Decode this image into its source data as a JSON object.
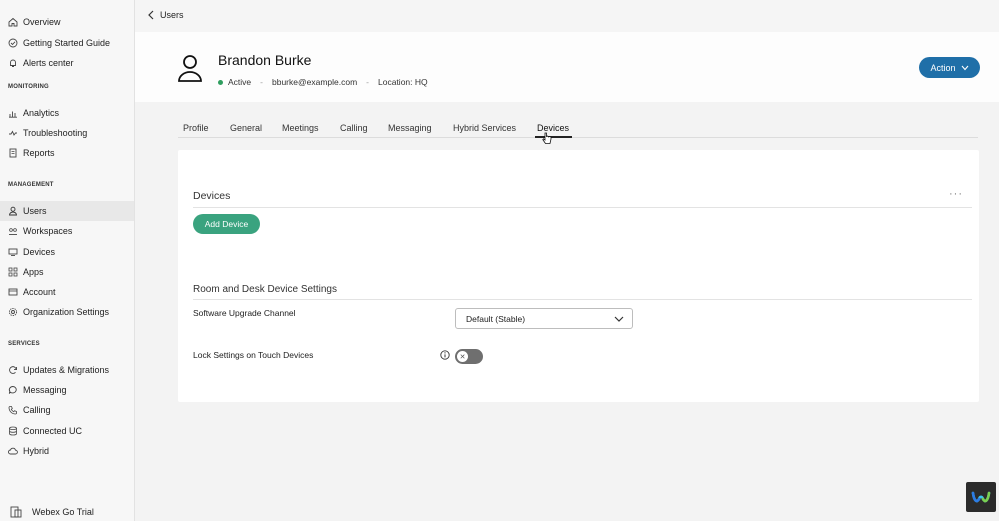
{
  "sidebar": {
    "top_items": [
      {
        "label": "Overview",
        "icon": "home-icon"
      },
      {
        "label": "Getting Started Guide",
        "icon": "check-circle-icon"
      },
      {
        "label": "Alerts center",
        "icon": "bell-icon"
      }
    ],
    "monitoring": {
      "label": "MONITORING",
      "items": [
        {
          "label": "Analytics",
          "icon": "bar-chart-icon"
        },
        {
          "label": "Troubleshooting",
          "icon": "pulse-icon"
        },
        {
          "label": "Reports",
          "icon": "report-icon"
        }
      ]
    },
    "management": {
      "label": "MANAGEMENT",
      "items": [
        {
          "label": "Users",
          "icon": "user-icon"
        },
        {
          "label": "Workspaces",
          "icon": "workspaces-icon"
        },
        {
          "label": "Devices",
          "icon": "device-icon"
        },
        {
          "label": "Apps",
          "icon": "apps-icon"
        },
        {
          "label": "Account",
          "icon": "account-icon"
        },
        {
          "label": "Organization Settings",
          "icon": "gear-icon"
        }
      ]
    },
    "services": {
      "label": "SERVICES",
      "items": [
        {
          "label": "Updates & Migrations",
          "icon": "refresh-icon"
        },
        {
          "label": "Messaging",
          "icon": "message-icon"
        },
        {
          "label": "Calling",
          "icon": "phone-icon"
        },
        {
          "label": "Connected UC",
          "icon": "database-icon"
        },
        {
          "label": "Hybrid",
          "icon": "cloud-icon"
        }
      ]
    },
    "trial_label": "Webex Go Trial"
  },
  "breadcrumb": {
    "back_label": "Users"
  },
  "user": {
    "name": "Brandon Burke",
    "status": "Active",
    "email": "bburke@example.com",
    "location": "Location: HQ"
  },
  "action_button": {
    "label": "Action"
  },
  "tabs": [
    {
      "label": "Profile"
    },
    {
      "label": "General"
    },
    {
      "label": "Meetings"
    },
    {
      "label": "Calling"
    },
    {
      "label": "Messaging"
    },
    {
      "label": "Hybrid Services"
    },
    {
      "label": "Devices"
    }
  ],
  "active_tab": "Devices",
  "devices_card": {
    "title": "Devices",
    "add_button": "Add Device",
    "settings_title": "Room and Desk Device Settings",
    "upgrade_channel_label": "Software Upgrade Channel",
    "upgrade_channel_value": "Default (Stable)",
    "lock_settings_label": "Lock Settings on Touch Devices",
    "lock_settings_enabled": false
  },
  "colors": {
    "accent_blue": "#1f6fa8",
    "add_green": "#3aa37f",
    "status_green": "#2f9e5f"
  }
}
